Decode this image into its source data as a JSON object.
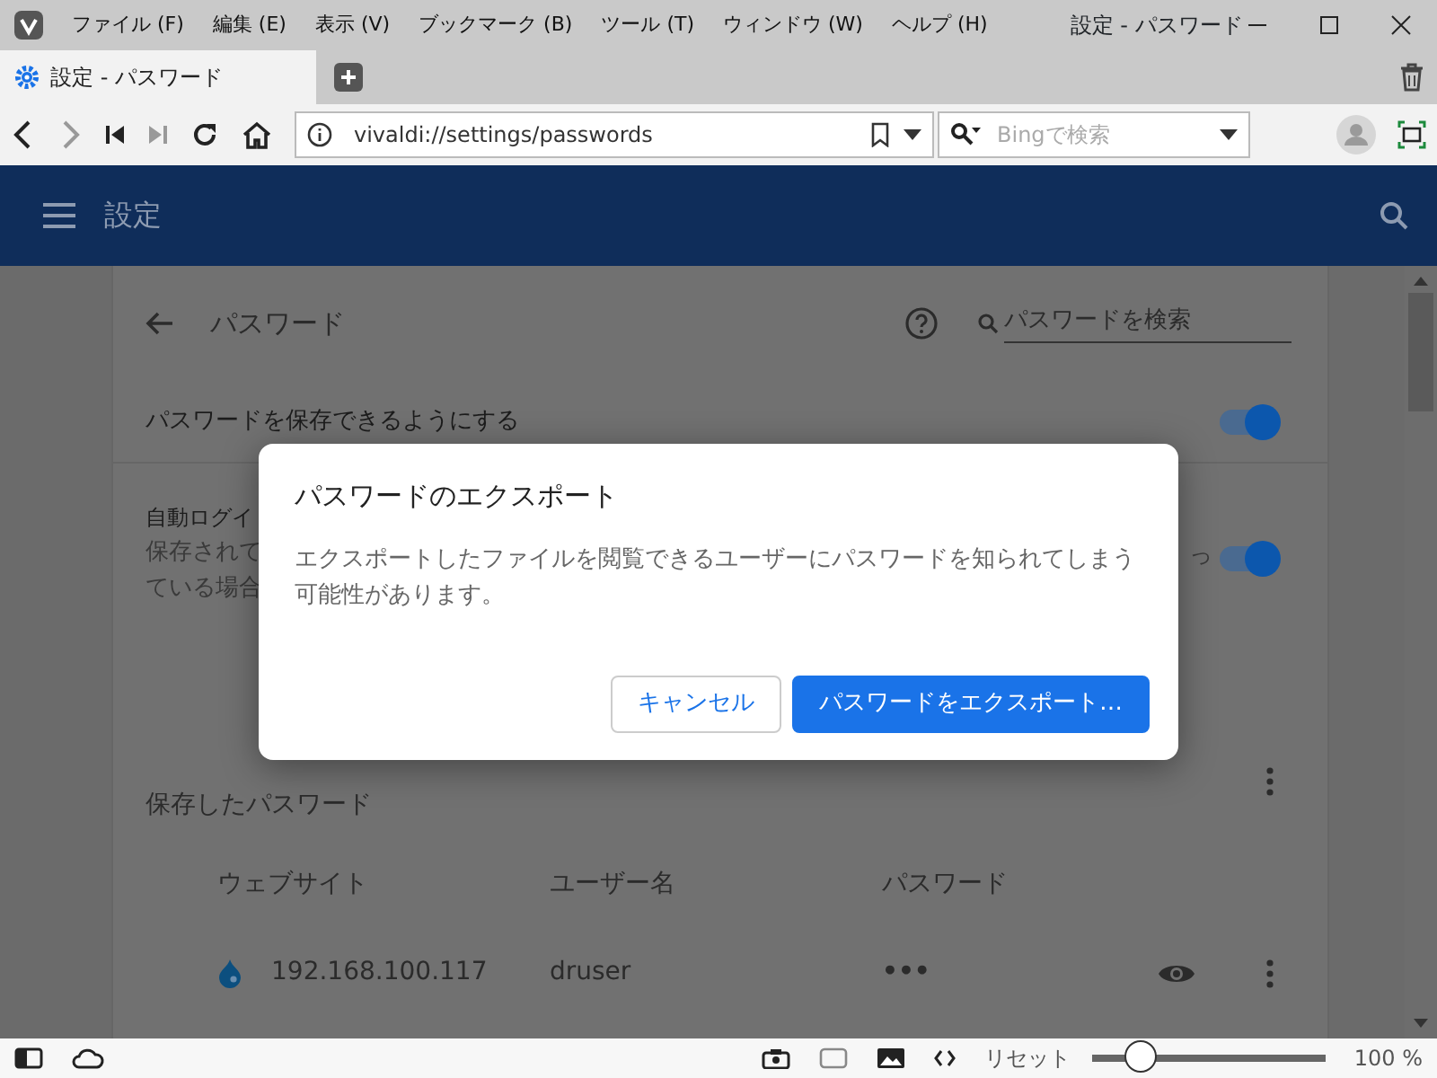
{
  "menu_bar": {
    "items": [
      "ファイル (F)",
      "編集 (E)",
      "表示 (V)",
      "ブックマーク (B)",
      "ツール (T)",
      "ウィンドウ (W)",
      "ヘルプ (H)"
    ],
    "title": "設定 - パスワード"
  },
  "tabs": [
    {
      "label": "設定 - パスワード",
      "selected": true
    }
  ],
  "address_bar": {
    "url": "vivaldi://settings/passwords"
  },
  "search_field": {
    "placeholder": "Bingで検索"
  },
  "header": {
    "title": "設定"
  },
  "page": {
    "title": "パスワード",
    "search": {
      "placeholder": "パスワードを検索"
    },
    "settings": [
      {
        "label": "パスワードを保存できるようにする",
        "on": true
      },
      {
        "label": "自動ログイ",
        "lines": [
          "保存されて",
          "ている場合"
        ],
        "tail": "っ",
        "on": true
      }
    ],
    "saved_title": "保存したパスワード",
    "columns": [
      "ウェブサイト",
      "ユーザー名",
      "パスワード"
    ],
    "rows": [
      {
        "website": "192.168.100.117",
        "username": "druser",
        "password": "•••"
      }
    ]
  },
  "dialog": {
    "title": "パスワードのエクスポート",
    "message": "エクスポートしたファイルを閲覧できるユーザーにパスワードを知られてしまう可能性があります。",
    "buttons": [
      {
        "label": "キャンセル",
        "kind": "secondary"
      },
      {
        "label": "パスワードをエクスポート…",
        "kind": "primary"
      }
    ]
  },
  "status_bar": {
    "reset": "リセット",
    "zoom": "100 %",
    "level": 0.21
  }
}
